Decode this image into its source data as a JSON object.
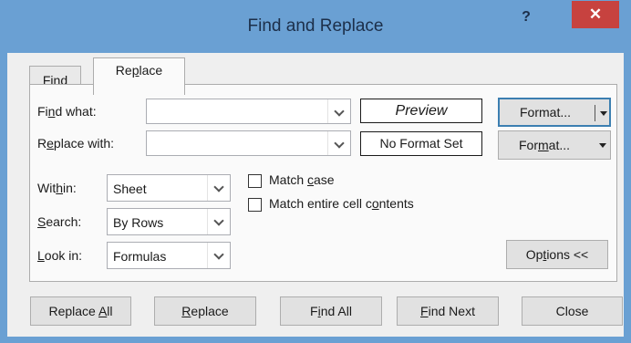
{
  "window": {
    "title": "Find and Replace",
    "help_glyph": "?",
    "close_glyph": "✕"
  },
  "tabs": [
    {
      "pre": "Fi",
      "acc": "n",
      "post": "d"
    },
    {
      "pre": "Re",
      "acc": "p",
      "post": "lace"
    }
  ],
  "find_what": {
    "pre": "Fi",
    "acc": "n",
    "post": "d what:",
    "value": ""
  },
  "replace_with": {
    "pre": "R",
    "acc": "e",
    "post": "place with:",
    "value": ""
  },
  "preview": {
    "find_label": "Preview",
    "replace_label": "No Format Set"
  },
  "format1": {
    "pre": "Format...",
    "acc": "",
    "post": ""
  },
  "format2": {
    "pre": "For",
    "acc": "m",
    "post": "at..."
  },
  "within": {
    "pre": "Wit",
    "acc": "h",
    "post": "in:",
    "value": "Sheet"
  },
  "search": {
    "pre": "",
    "acc": "S",
    "post": "earch:",
    "value": "By Rows"
  },
  "look_in": {
    "pre": "",
    "acc": "L",
    "post": "ook in:",
    "value": "Formulas"
  },
  "match_case": {
    "pre": "Match ",
    "acc": "c",
    "post": "ase",
    "checked": false
  },
  "match_entire": {
    "pre": "Match entire cell c",
    "acc": "o",
    "post": "ntents",
    "checked": false
  },
  "options_button": {
    "pre": "Op",
    "acc": "t",
    "post": "ions <<"
  },
  "buttons": {
    "replace_all": {
      "pre": "Replace ",
      "acc": "A",
      "post": "ll"
    },
    "replace": {
      "pre": "",
      "acc": "R",
      "post": "eplace"
    },
    "find_all": {
      "pre": "F",
      "acc": "i",
      "post": "nd All"
    },
    "find_next": {
      "pre": "",
      "acc": "F",
      "post": "ind Next"
    },
    "close": {
      "pre": "Close",
      "acc": "",
      "post": ""
    }
  },
  "colors": {
    "frame": "#6aa0d3",
    "close_button": "#c7423f",
    "client": "#efefef",
    "default_button_border": "#3c7fb1"
  }
}
